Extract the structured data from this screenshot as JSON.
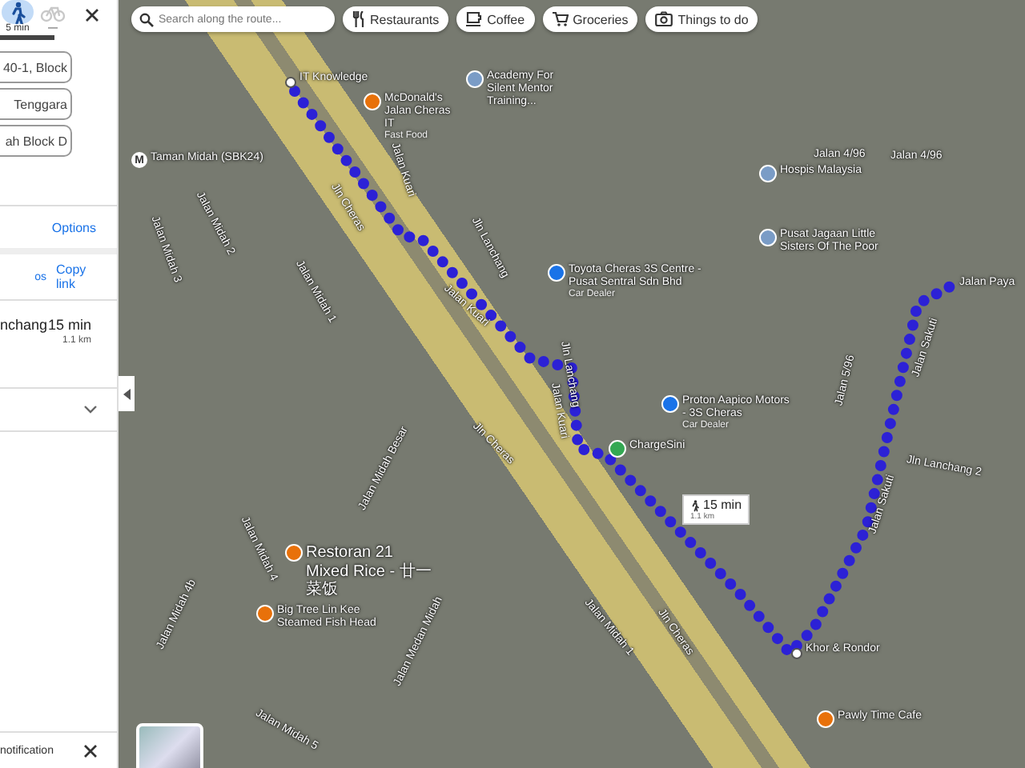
{
  "panel": {
    "modes": [
      {
        "kind": "walk",
        "label": "5 min",
        "selected": true
      },
      {
        "kind": "bike",
        "label": "—",
        "selected": false
      }
    ],
    "fields": [
      "40-1, Block",
      "Tenggara",
      "ah Block D"
    ],
    "options_link": "Options",
    "share_text": "os",
    "copy_link": "Copy link",
    "route": {
      "via": "nchang",
      "time": "15 min",
      "distance": "1.1 km"
    },
    "notification": "notification"
  },
  "search": {
    "placeholder": "Search along the route..."
  },
  "chips": [
    {
      "kind": "restaurants",
      "label": "Restaurants"
    },
    {
      "kind": "coffee",
      "label": "Coffee"
    },
    {
      "kind": "groceries",
      "label": "Groceries"
    },
    {
      "kind": "things",
      "label": "Things to do"
    }
  ],
  "map": {
    "labels": [
      {
        "kind": "road",
        "text": "Jln Cheras"
      },
      {
        "kind": "road",
        "text": "Jalan Kuari"
      },
      {
        "kind": "road",
        "text": "Jalan Kuari"
      },
      {
        "kind": "road",
        "text": "Jalan Kuari"
      },
      {
        "kind": "road",
        "text": "Jln Lanchang"
      },
      {
        "kind": "road",
        "text": "Jln Lanchang"
      },
      {
        "kind": "road",
        "text": "Jalan Midah 1"
      },
      {
        "kind": "road",
        "text": "Jalan Midah 2"
      },
      {
        "kind": "road",
        "text": "Jalan Midah 3"
      },
      {
        "kind": "road",
        "text": "Jalan Midah Besar"
      },
      {
        "kind": "road",
        "text": "Jalan Midah 4"
      },
      {
        "kind": "road",
        "text": "Jalan Medan Midah"
      },
      {
        "kind": "road",
        "text": "Jalan Midah 4b"
      },
      {
        "kind": "road",
        "text": "Jalan Midah 5"
      },
      {
        "kind": "road",
        "text": "Jln Cheras"
      },
      {
        "kind": "road",
        "text": "Jln Cheras"
      },
      {
        "kind": "road",
        "text": "Jalan 4/96"
      },
      {
        "kind": "road",
        "text": "Jalan 4/96"
      },
      {
        "kind": "road",
        "text": "Jalan 5/96"
      },
      {
        "kind": "road",
        "text": "Jalan Sakuti"
      },
      {
        "kind": "road",
        "text": "Jalan Sakuti"
      },
      {
        "kind": "road",
        "text": "Jln Lanchang 2"
      },
      {
        "kind": "road",
        "text": "Jalan Paya"
      },
      {
        "kind": "road",
        "text": "Jalan Midah 1"
      },
      {
        "kind": "dot",
        "text": "IT Knowledge"
      },
      {
        "kind": "place",
        "text": "McDonald's Jalan Cheras IT",
        "subtitle": "Fast Food",
        "color": "#e8710a"
      },
      {
        "kind": "place",
        "text": "Academy For Silent Mentor Training...",
        "color": "#7a9cc6"
      },
      {
        "kind": "station",
        "text": "Taman Midah (SBK24)",
        "icon": "M"
      },
      {
        "kind": "place",
        "text": "Toyota Cheras 3S Centre - Pusat Sentral Sdn Bhd",
        "subtitle": "Car Dealer",
        "color": "#1a73e8"
      },
      {
        "kind": "place",
        "text": "Hospis Malaysia",
        "color": "#7a9cc6"
      },
      {
        "kind": "place",
        "text": "Pusat Jagaan Little Sisters Of The Poor",
        "color": "#7a9cc6"
      },
      {
        "kind": "place",
        "text": "Proton Aapico Motors - 3S Cheras",
        "subtitle": "Car Dealer",
        "color": "#1a73e8"
      },
      {
        "kind": "place",
        "text": "ChargeSini",
        "color": "#34a853"
      },
      {
        "kind": "place",
        "text": "Restoran 21 Mixed Rice - 廿一菜饭",
        "color": "#e8710a"
      },
      {
        "kind": "place",
        "text": "Big Tree Lin Kee Steamed Fish Head",
        "color": "#e8710a"
      },
      {
        "kind": "dot",
        "text": "Khor & Rondor"
      },
      {
        "kind": "place",
        "text": "Pawly Time Cafe",
        "color": "#e8710a"
      }
    ],
    "callout": {
      "time": "15 min",
      "distance": "1.1 km"
    }
  }
}
